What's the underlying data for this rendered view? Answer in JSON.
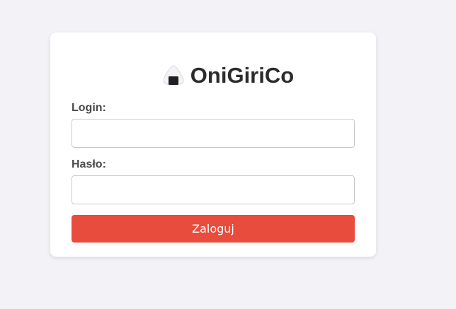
{
  "brand": {
    "icon": "onigiri-icon",
    "title": "OniGiriCo"
  },
  "form": {
    "login": {
      "label": "Login:",
      "value": "",
      "placeholder": ""
    },
    "password": {
      "label": "Hasło:",
      "value": "",
      "placeholder": ""
    },
    "submit_label": "Zaloguj"
  },
  "colors": {
    "background": "#f3f2f7",
    "card": "#ffffff",
    "accent": "#e74c3c",
    "text": "#2c2c2c"
  }
}
